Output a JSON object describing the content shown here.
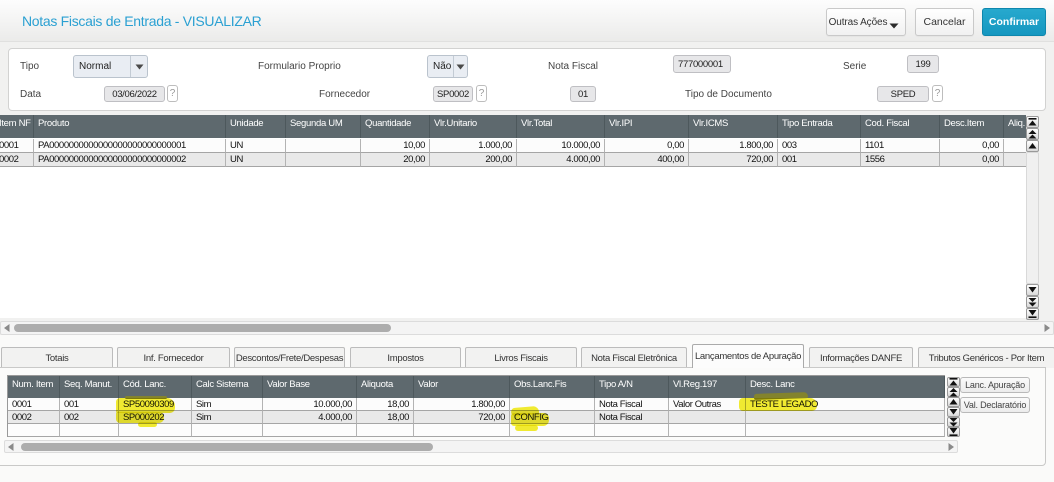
{
  "title": "Notas Fiscais de Entrada - VISUALIZAR",
  "toolbar": {
    "outras_acoes_label": "Outras Ações",
    "cancelar_label": "Cancelar",
    "confirmar_label": "Confirmar"
  },
  "form": {
    "tipo_label": "Tipo",
    "tipo_value": "Normal",
    "formulario_proprio_label": "Formulario Proprio",
    "formulario_proprio_value": "Não",
    "nota_fiscal_label": "Nota Fiscal",
    "nota_fiscal_value": "777000001",
    "serie_label": "Serie",
    "serie_value": "199",
    "data_label": "Data",
    "data_value": "03/06/2022",
    "fornecedor_label": "Fornecedor",
    "fornecedor_value": "SP0002",
    "loja_value": "01",
    "tipo_documento_label": "Tipo de Documento",
    "tipo_documento_value": "SPED",
    "help_button_label": "?"
  },
  "items_grid": {
    "headers": [
      "Item NF",
      "Produto",
      "Unidade",
      "Segunda UM",
      "Quantidade",
      "Vlr.Unitario",
      "Vlr.Total",
      "Vlr.IPI",
      "Vlr.ICMS",
      "Tipo Entrada",
      "Cod. Fiscal",
      "Desc.Item",
      "Aliq. IC"
    ],
    "rows": [
      [
        "0001",
        "PA0000000000000000000000000001",
        "UN",
        "",
        "10,00",
        "1.000,00",
        "10.000,00",
        "0,00",
        "1.800,00",
        "003",
        "1101",
        "0,00",
        ""
      ],
      [
        "0002",
        "PA0000000000000000000000000002",
        "UN",
        "",
        "20,00",
        "200,00",
        "4.000,00",
        "400,00",
        "720,00",
        "001",
        "1556",
        "0,00",
        ""
      ]
    ]
  },
  "tabs": [
    {
      "label": "Totais",
      "active": false
    },
    {
      "label": "Inf. Fornecedor",
      "active": false
    },
    {
      "label": "Descontos/Frete/Despesas",
      "active": false
    },
    {
      "label": "Impostos",
      "active": false
    },
    {
      "label": "Livros Fiscais",
      "active": false
    },
    {
      "label": "Nota Fiscal Eletrônica",
      "active": false
    },
    {
      "label": "Lançamentos de Apuração",
      "active": true
    },
    {
      "label": "Informações DANFE",
      "active": false
    },
    {
      "label": "Tributos Genéricos - Por Item",
      "active": false
    }
  ],
  "apuracao_grid": {
    "headers": [
      "Num. Item",
      "Seq. Manut.",
      "Cód. Lanc.",
      "Calc Sistema",
      "Valor Base",
      "Aliquota",
      "Valor",
      "Obs.Lanc.Fis",
      "Tipo A/N",
      "Vl.Reg.197",
      "Desc. Lanc"
    ],
    "rows": [
      [
        "0001",
        "001",
        "SP50090309",
        "Sim",
        "10.000,00",
        "18,00",
        "1.800,00",
        "",
        "Nota Fiscal",
        "Valor Outras",
        "TESTE LEGADO"
      ],
      [
        "0002",
        "002",
        "SP000202",
        "Sim",
        "4.000,00",
        "18,00",
        "720,00",
        "CONFIG",
        "Nota Fiscal",
        "",
        ""
      ]
    ]
  },
  "side_buttons": {
    "lanc_apuracao_label": "Lanc. Apuração",
    "val_declaratorio_label": "Val. Declaratório"
  },
  "highlight_color": "#f2ec1f"
}
